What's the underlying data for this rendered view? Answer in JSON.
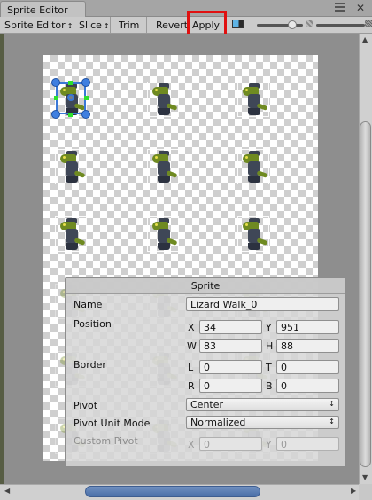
{
  "window": {
    "tab_title": "Sprite Editor"
  },
  "toolbar": {
    "mode_label": "Sprite Editor",
    "slice_label": "Slice",
    "trim_label": "Trim",
    "revert_label": "Revert",
    "apply_label": "Apply",
    "arrow_glyph": "↕",
    "highlight_color": "#e01010",
    "icons": [
      "color-channel-icon",
      "zoom-slider",
      "mipmap-icon"
    ]
  },
  "sprite_sheet": {
    "selected_sprite_index": 0,
    "sprite_count": 9,
    "palette": {
      "skin": "#6f8a21",
      "uniform": "#3f4757",
      "selection": "#3a78d6",
      "handle_dot": "#2ee02e"
    }
  },
  "panel": {
    "title": "Sprite",
    "name_label": "Name",
    "name_value": "Lizard Walk_0",
    "position_label": "Position",
    "x_label": "X",
    "x_value": "34",
    "y_label": "Y",
    "y_value": "951",
    "w_label": "W",
    "w_value": "83",
    "h_label": "H",
    "h_value": "88",
    "border_label": "Border",
    "l_label": "L",
    "l_value": "0",
    "t_label": "T",
    "t_value": "0",
    "r_label": "R",
    "r_value": "0",
    "b_label": "B",
    "b_value": "0",
    "pivot_label": "Pivot",
    "pivot_value": "Center",
    "pivot_unit_label": "Pivot Unit Mode",
    "pivot_unit_value": "Normalized",
    "custom_pivot_label": "Custom Pivot",
    "cp_x_label": "X",
    "cp_x_value": "0",
    "cp_y_label": "Y",
    "cp_y_value": "0"
  }
}
